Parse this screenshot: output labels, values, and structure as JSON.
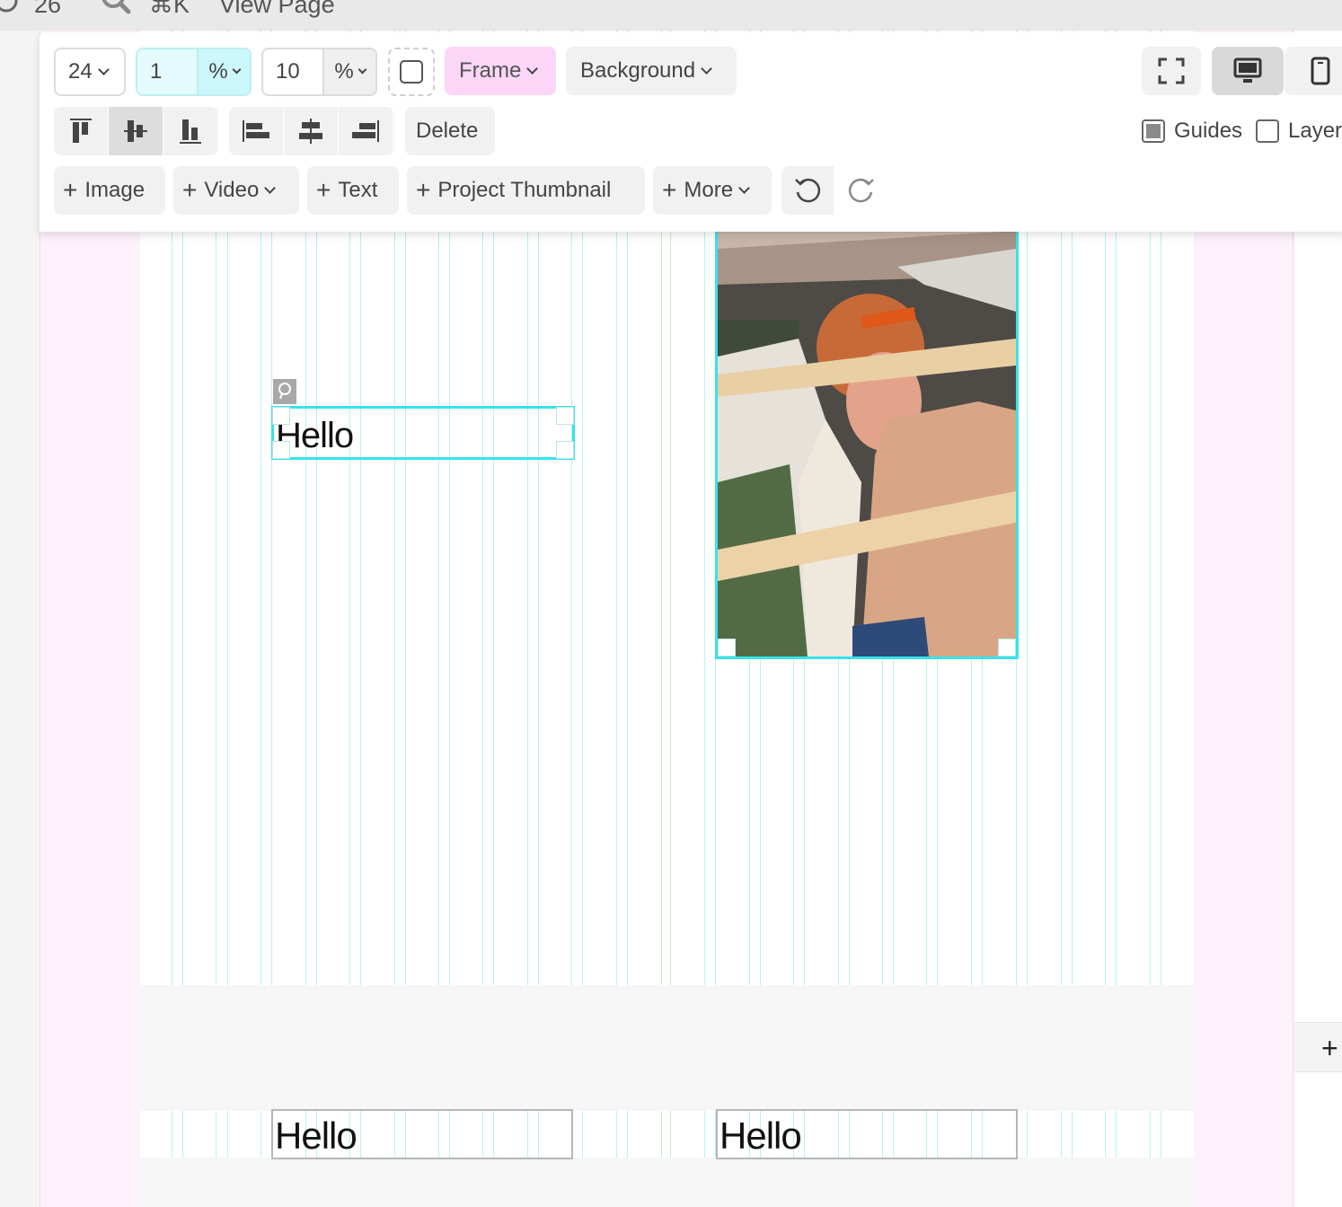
{
  "topbar": {
    "count": "26",
    "shortcut": "⌘K",
    "view_page": "View Page"
  },
  "toolbar": {
    "font_size": "24",
    "spacing_value": "1",
    "spacing_unit": "%",
    "padding_value": "10",
    "padding_unit": "%",
    "frame_label": "Frame",
    "background_label": "Background",
    "delete_label": "Delete",
    "guides_label": "Guides",
    "guides_checked": true,
    "layers_label": "Layers",
    "layers_checked": false,
    "vertical_align_options": [
      "top",
      "middle",
      "bottom"
    ],
    "vertical_align_selected": "middle",
    "horizontal_align_options": [
      "left",
      "center",
      "right"
    ],
    "device_selected": "desktop",
    "add_buttons": {
      "image": "Image",
      "video": "Video",
      "text": "Text",
      "thumbnail": "Project Thumbnail",
      "more": "More"
    }
  },
  "canvas": {
    "text_block_selected": "Hello",
    "text_block_bottom_left": "Hello",
    "text_block_bottom_right": "Hello"
  },
  "colors": {
    "selection": "#35e3ec",
    "frame_accent": "#fbd6f6",
    "canvas_margin": "#fdf2fc",
    "guide_line": "#bdeff3"
  }
}
